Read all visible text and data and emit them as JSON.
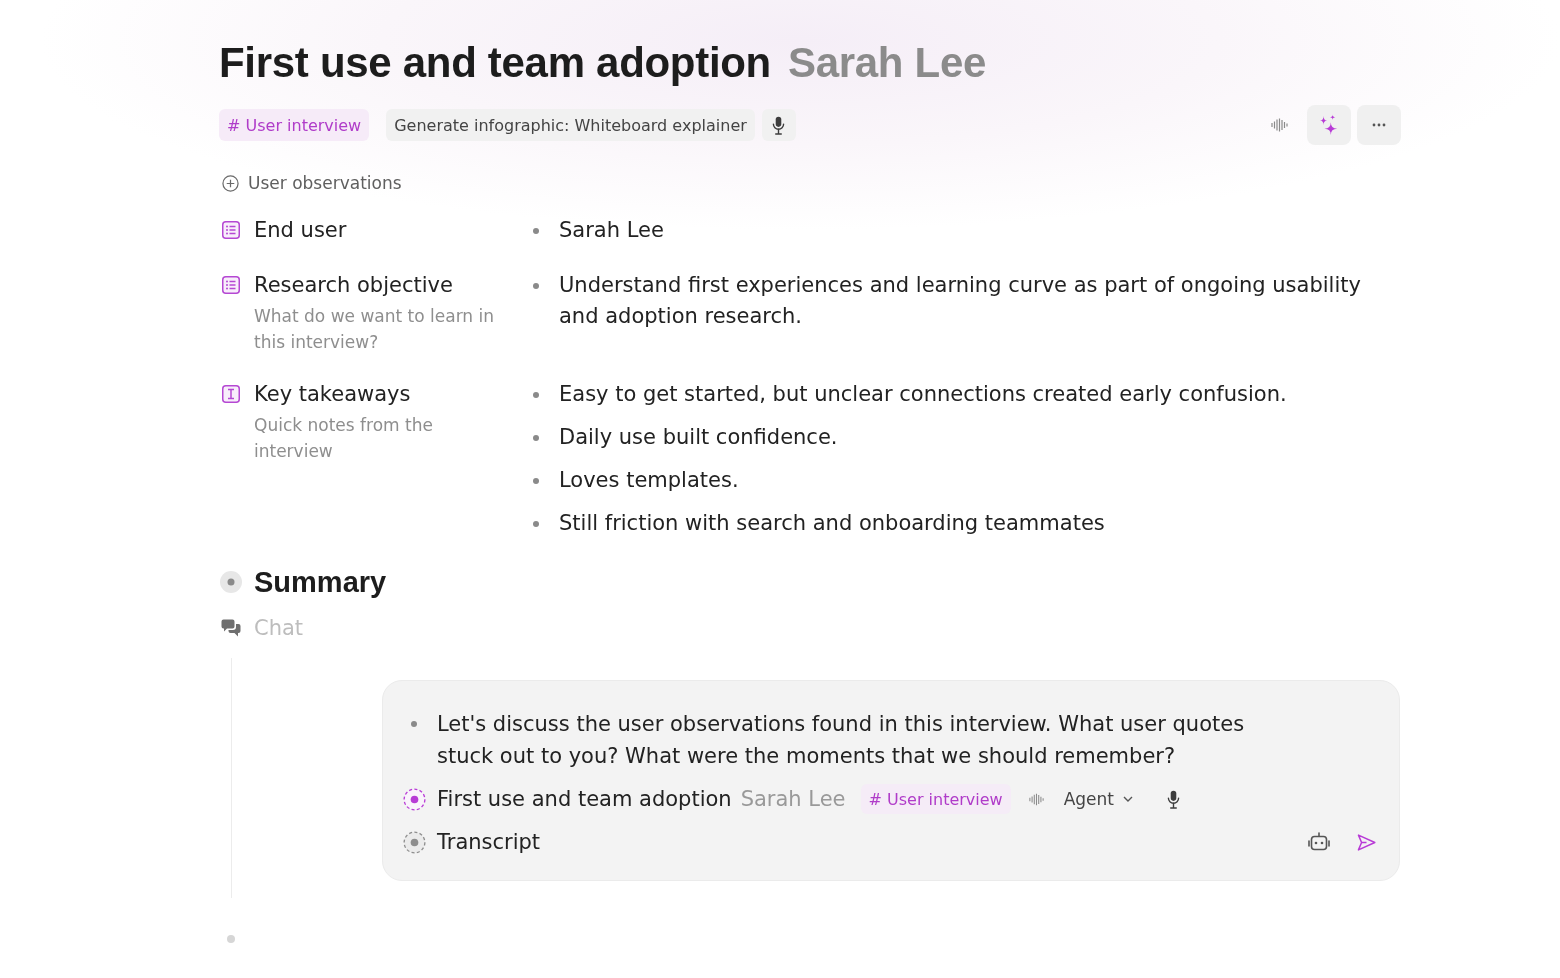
{
  "title": {
    "text": "First use and team adoption",
    "author": "Sarah Lee"
  },
  "toolbar": {
    "tag": "# User interview",
    "action": "Generate infographic: Whiteboard explainer"
  },
  "section_link": "User observations",
  "properties": [
    {
      "kind": "list",
      "label": "End user",
      "values": [
        "Sarah Lee"
      ]
    },
    {
      "kind": "list",
      "label": "Research objective",
      "description": "What do we want to learn in this interview?",
      "values": [
        "Understand first experiences and learning curve as part of ongoing usability and adoption research."
      ]
    },
    {
      "kind": "text",
      "label": "Key takeaways",
      "description": "Quick notes from the interview",
      "values": [
        "Easy to get started, but unclear connections created early confusion.",
        "Daily use built confidence.",
        "Loves templates.",
        "Still friction with search and onboarding teammates"
      ]
    }
  ],
  "sections": [
    {
      "kind": "summary",
      "label": "Summary"
    },
    {
      "kind": "chat",
      "label": "Chat"
    }
  ],
  "chat": {
    "message": "Let's discuss the user observations found in this interview. What user quotes stuck out to you? What were the moments that we should remember?",
    "context": [
      {
        "title": "First use and team adoption",
        "author": "Sarah Lee",
        "tag": "# User interview",
        "selected": true
      },
      {
        "title": "Transcript",
        "selected": false
      }
    ],
    "mode": "Agent"
  }
}
